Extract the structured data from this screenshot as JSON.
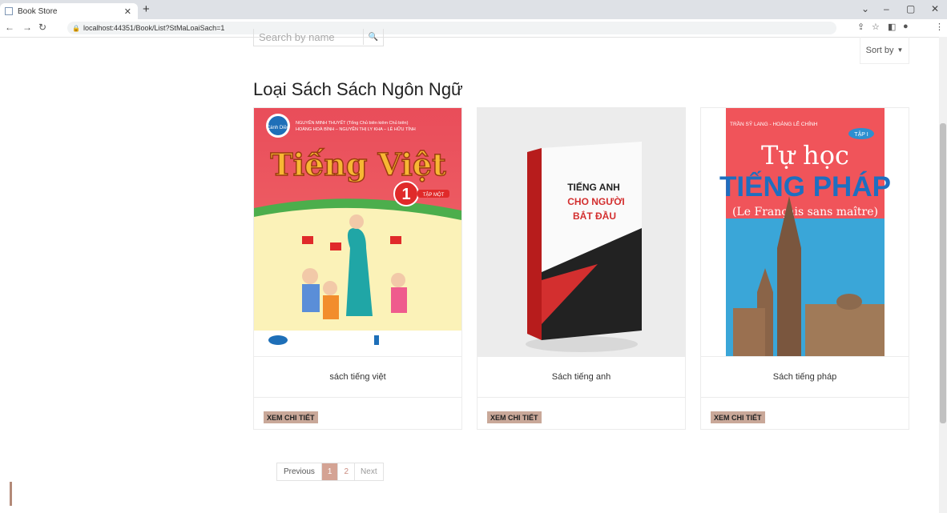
{
  "browser": {
    "tab_title": "Book Store",
    "url": "localhost:44351/Book/List?StMaLoaiSach=1"
  },
  "toolbar": {
    "search_placeholder": "Search by name",
    "sort_label": "Sort by"
  },
  "page": {
    "heading": "Loại Sách Sách Ngôn Ngữ"
  },
  "books": [
    {
      "title": "sách tiếng việt",
      "detail_label": "XEM CHI TIẾT",
      "cover": {
        "authors_line1": "NGUYỄN MINH THUYẾT (Tổng Chủ biên kiêm Chủ biên)",
        "authors_line2": "HOÀNG HOÀ BÌNH – NGUYỄN THỊ LY KHA – LÊ HỮU TỈNH",
        "logo": "Cánh Diều",
        "title": "Tiếng Việt",
        "grade": "1",
        "volume": "TẬP MỘT",
        "colors": {
          "bg": "#e94d5a",
          "title": "#f7b733"
        }
      }
    },
    {
      "title": "Sách tiếng anh",
      "detail_label": "XEM CHI TIẾT",
      "cover": {
        "line1": "TIẾNG ANH",
        "line2": "CHO NGƯỜI",
        "line3": "BẮT ĐẦU",
        "colors": {
          "accent": "#d32f2f"
        }
      }
    },
    {
      "title": "Sách tiếng pháp",
      "detail_label": "XEM CHI TIẾT",
      "cover": {
        "authors": "TRẦN SỸ LANG - HOÀNG LÊ CHÍNH",
        "volume": "TẬP I",
        "title_line1": "Tự học",
        "title_line2": "TIẾNG PHÁP",
        "subtitle": "(Le Français sans maître)",
        "colors": {
          "bg": "#f0545a",
          "blue": "#3aa6d8"
        }
      }
    }
  ],
  "pagination": {
    "previous": "Previous",
    "pages": [
      "1",
      "2"
    ],
    "next": "Next",
    "active": "1"
  }
}
